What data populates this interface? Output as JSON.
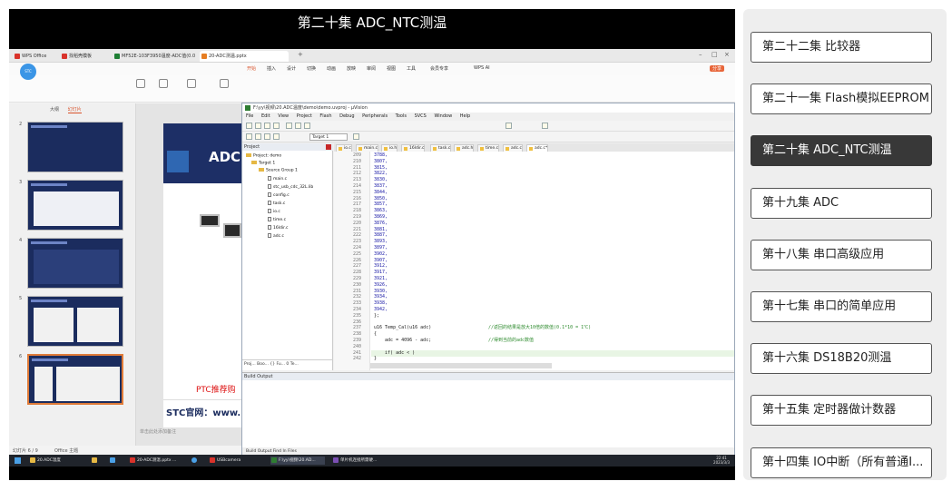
{
  "video": {
    "title": "第二十集 ADC_NTC测温",
    "browser_tabs": [
      {
        "label": "WPS Office",
        "color": "#d9332b"
      },
      {
        "label": "找稻壳模板",
        "color": "#d9332b"
      },
      {
        "label": "MF52E-103F3950温度-ADC值(0.0",
        "color": "#1e7e34"
      },
      {
        "label": "20-ADC测温.pptx",
        "color": "#e67e22"
      }
    ],
    "ribbon_menu": [
      "开始",
      "插入",
      "设计",
      "切换",
      "动画",
      "放映",
      "审阅",
      "视图",
      "工具",
      "会员专享",
      "WPS AI"
    ],
    "ribbon_active": "开始",
    "share_label": "分享",
    "avatar_label": "STC",
    "panel_tabs": [
      "大纲",
      "幻灯片"
    ],
    "slide_numbers": [
      "2",
      "3",
      "4",
      "5",
      "6"
    ],
    "slide_main_text": "ADC",
    "slide_red_text": "PTC推荐购",
    "slide_stc_text": "STC官网：www.ST",
    "notes_hint": "单击此处添加备注",
    "status_left": "幻灯片 6 / 9",
    "status_office": "Office 主题",
    "uvision": {
      "title": "F:\\yy\\视频\\20.ADC温度\\demo\\demo.uvproj - µVision",
      "menu": [
        "File",
        "Edit",
        "View",
        "Project",
        "Flash",
        "Debug",
        "Peripherals",
        "Tools",
        "SVCS",
        "Window",
        "Help"
      ],
      "target": "Target 1",
      "project_header": "Project",
      "tree": [
        {
          "label": "Project: demo",
          "type": "root",
          "indent": 0
        },
        {
          "label": "Target 1",
          "type": "folder",
          "indent": 1
        },
        {
          "label": "Source Group 1",
          "type": "folder",
          "indent": 2
        },
        {
          "label": "main.c",
          "type": "file",
          "indent": 3
        },
        {
          "label": "stc_usb_cdc_32L.lib",
          "type": "file",
          "indent": 3
        },
        {
          "label": "config.c",
          "type": "file",
          "indent": 3
        },
        {
          "label": "task.c",
          "type": "file",
          "indent": 3
        },
        {
          "label": "io.c",
          "type": "file",
          "indent": 3
        },
        {
          "label": "time.c",
          "type": "file",
          "indent": 3
        },
        {
          "label": "16ldir.c",
          "type": "file",
          "indent": 3
        },
        {
          "label": "adc.c",
          "type": "file",
          "indent": 3
        }
      ],
      "project_tabs": "Proj...  Boo...  {} Fu...  0 Te...",
      "editor_tabs": [
        "io.c",
        "main.c",
        "io.h",
        "16ldir.c",
        "task.c",
        "adc.h",
        "time.c",
        "adc.c",
        "adc.c*"
      ],
      "code_lines": [
        {
          "n": "209",
          "t": "3788,",
          "kind": "num"
        },
        {
          "n": "210",
          "t": "3807,",
          "kind": "num"
        },
        {
          "n": "211",
          "t": "3815,",
          "kind": "num"
        },
        {
          "n": "212",
          "t": "3822,",
          "kind": "num"
        },
        {
          "n": "213",
          "t": "3830,",
          "kind": "num"
        },
        {
          "n": "214",
          "t": "3837,",
          "kind": "num"
        },
        {
          "n": "215",
          "t": "3844,",
          "kind": "num"
        },
        {
          "n": "216",
          "t": "3850,",
          "kind": "num"
        },
        {
          "n": "217",
          "t": "3857,",
          "kind": "num"
        },
        {
          "n": "218",
          "t": "3863,",
          "kind": "num"
        },
        {
          "n": "219",
          "t": "3869,",
          "kind": "num"
        },
        {
          "n": "220",
          "t": "3876,",
          "kind": "num"
        },
        {
          "n": "221",
          "t": "3881,",
          "kind": "num"
        },
        {
          "n": "222",
          "t": "3887,",
          "kind": "num"
        },
        {
          "n": "223",
          "t": "3893,",
          "kind": "num"
        },
        {
          "n": "224",
          "t": "3897,",
          "kind": "num"
        },
        {
          "n": "225",
          "t": "3902,",
          "kind": "num"
        },
        {
          "n": "226",
          "t": "3907,",
          "kind": "num"
        },
        {
          "n": "227",
          "t": "3912,",
          "kind": "num"
        },
        {
          "n": "228",
          "t": "3917,",
          "kind": "num"
        },
        {
          "n": "229",
          "t": "3921,",
          "kind": "num"
        },
        {
          "n": "230",
          "t": "3926,",
          "kind": "num"
        },
        {
          "n": "231",
          "t": "3930,",
          "kind": "num"
        },
        {
          "n": "232",
          "t": "3934,",
          "kind": "num"
        },
        {
          "n": "233",
          "t": "3938,",
          "kind": "num"
        },
        {
          "n": "234",
          "t": "3942,",
          "kind": "num"
        },
        {
          "n": "235",
          "t": "};",
          "kind": "code"
        },
        {
          "n": "236",
          "t": "",
          "kind": "code"
        },
        {
          "n": "237",
          "t": "u16 Temp_Cal(u16 adc)",
          "comment": "//返回的结果是放大10倍的数值(0.1*10 = 1℃)",
          "kind": "code"
        },
        {
          "n": "238",
          "t": "{",
          "kind": "code"
        },
        {
          "n": "239",
          "t": "    adc = 4096 - adc;",
          "comment": "//得到当前的adc数值",
          "kind": "code"
        },
        {
          "n": "240",
          "t": "",
          "kind": "code"
        },
        {
          "n": "241",
          "t": "    if( adc < )",
          "kind": "code",
          "highlight": true
        },
        {
          "n": "242",
          "t": "}",
          "kind": "code"
        }
      ],
      "build_header": "Build Output",
      "build_tabs": "Build Output   Find In Files"
    },
    "taskbar": [
      {
        "label": "20.ADC温度",
        "color": "#e6b844"
      },
      {
        "label": "",
        "color": "#e6b844"
      },
      {
        "label": "",
        "color": "#4aa0e6"
      },
      {
        "label": "20-ADC测温.pptx ...",
        "color": "#d9332b"
      },
      {
        "label": "",
        "color": "#4aa0e6"
      },
      {
        "label": "USBcamera",
        "color": "#d9332b"
      },
      {
        "label": "F:\\yy\\视频\\20.AD...",
        "color": "#2f7d32"
      },
      {
        "label": "单片机连接所需硬...",
        "color": "#7b4fb3"
      }
    ],
    "clock": {
      "time": "22:41",
      "date": "2023/3/3"
    }
  },
  "playlist": {
    "items": [
      {
        "label": "第二十二集 比较器",
        "active": false
      },
      {
        "label": "第二十一集 Flash模拟EEPROM",
        "active": false
      },
      {
        "label": "第二十集 ADC_NTC测温",
        "active": true
      },
      {
        "label": "第十九集 ADC",
        "active": false
      },
      {
        "label": "第十八集 串口高级应用",
        "active": false
      },
      {
        "label": "第十七集 串口的简单应用",
        "active": false
      },
      {
        "label": "第十六集 DS18B20测温",
        "active": false
      },
      {
        "label": "第十五集 定时器做计数器",
        "active": false
      },
      {
        "label": "第十四集 IO中断（所有普通I...",
        "active": false
      }
    ]
  }
}
